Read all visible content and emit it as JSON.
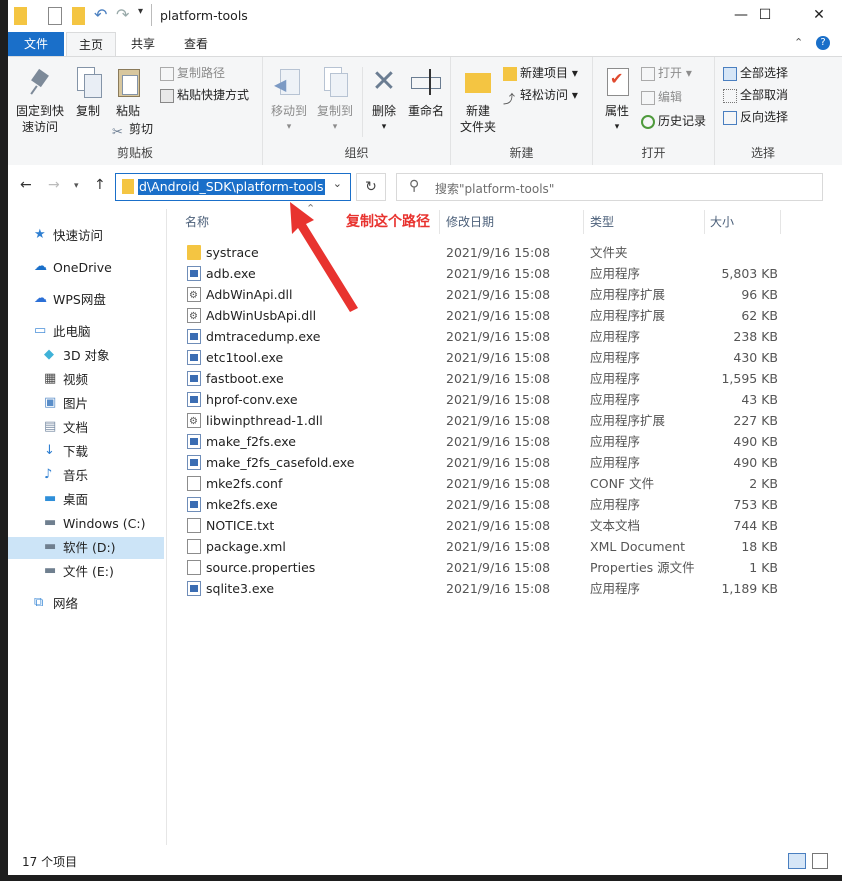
{
  "window": {
    "title": "platform-tools",
    "controls": {
      "minimize": "—",
      "maximize": "☐",
      "close": "✕"
    }
  },
  "tabs": [
    {
      "label": "文件"
    },
    {
      "label": "主页"
    },
    {
      "label": "共享"
    },
    {
      "label": "查看"
    }
  ],
  "ribbon": {
    "clipboard": {
      "group_label": "剪贴板",
      "pin_label_1": "固定到快",
      "pin_label_2": "速访问",
      "copy": "复制",
      "paste": "粘贴",
      "copy_path": "复制路径",
      "paste_shortcut": "粘贴快捷方式",
      "cut": "剪切"
    },
    "organize": {
      "group_label": "组织",
      "move_to": "移动到",
      "copy_to": "复制到",
      "delete": "删除",
      "rename": "重命名"
    },
    "new": {
      "group_label": "新建",
      "new_folder_1": "新建",
      "new_folder_2": "文件夹",
      "new_item": "新建项目 ▾",
      "easy_access": "轻松访问 ▾"
    },
    "open": {
      "group_label": "打开",
      "properties": "属性",
      "open": "打开 ▾",
      "edit": "编辑",
      "history": "历史记录"
    },
    "select": {
      "group_label": "选择",
      "select_all": "全部选择",
      "select_none": "全部取消",
      "invert": "反向选择"
    }
  },
  "address": {
    "path": "d\\Android_SDK\\platform-tools",
    "search_placeholder": "搜索\"platform-tools\""
  },
  "annotation": "复制这个路径",
  "nav_pane": [
    {
      "label": "快速访问",
      "icon": "star-icon"
    },
    {
      "label": "OneDrive",
      "icon": "cloud-icon"
    },
    {
      "label": "WPS网盘",
      "icon": "cloud-outline-icon"
    },
    {
      "label": "此电脑",
      "icon": "computer-icon"
    },
    {
      "label": "3D 对象",
      "icon": "cube-icon"
    },
    {
      "label": "视频",
      "icon": "film-icon"
    },
    {
      "label": "图片",
      "icon": "picture-icon"
    },
    {
      "label": "文档",
      "icon": "document-icon"
    },
    {
      "label": "下载",
      "icon": "download-icon"
    },
    {
      "label": "音乐",
      "icon": "music-icon"
    },
    {
      "label": "桌面",
      "icon": "desktop-icon"
    },
    {
      "label": "Windows (C:)",
      "icon": "drive-icon"
    },
    {
      "label": "软件 (D:)",
      "icon": "drive-icon"
    },
    {
      "label": "文件 (E:)",
      "icon": "drive-icon"
    },
    {
      "label": "网络",
      "icon": "network-icon"
    }
  ],
  "columns": {
    "name": "名称",
    "date": "修改日期",
    "type": "类型",
    "size": "大小"
  },
  "files": [
    {
      "name": "systrace",
      "date": "2021/9/16 15:08",
      "type": "文件夹",
      "size": "",
      "icon": "folder"
    },
    {
      "name": "adb.exe",
      "date": "2021/9/16 15:08",
      "type": "应用程序",
      "size": "5,803 KB",
      "icon": "exe"
    },
    {
      "name": "AdbWinApi.dll",
      "date": "2021/9/16 15:08",
      "type": "应用程序扩展",
      "size": "96 KB",
      "icon": "gear"
    },
    {
      "name": "AdbWinUsbApi.dll",
      "date": "2021/9/16 15:08",
      "type": "应用程序扩展",
      "size": "62 KB",
      "icon": "gear"
    },
    {
      "name": "dmtracedump.exe",
      "date": "2021/9/16 15:08",
      "type": "应用程序",
      "size": "238 KB",
      "icon": "exe"
    },
    {
      "name": "etc1tool.exe",
      "date": "2021/9/16 15:08",
      "type": "应用程序",
      "size": "430 KB",
      "icon": "exe"
    },
    {
      "name": "fastboot.exe",
      "date": "2021/9/16 15:08",
      "type": "应用程序",
      "size": "1,595 KB",
      "icon": "exe"
    },
    {
      "name": "hprof-conv.exe",
      "date": "2021/9/16 15:08",
      "type": "应用程序",
      "size": "43 KB",
      "icon": "exe"
    },
    {
      "name": "libwinpthread-1.dll",
      "date": "2021/9/16 15:08",
      "type": "应用程序扩展",
      "size": "227 KB",
      "icon": "gear"
    },
    {
      "name": "make_f2fs.exe",
      "date": "2021/9/16 15:08",
      "type": "应用程序",
      "size": "490 KB",
      "icon": "exe"
    },
    {
      "name": "make_f2fs_casefold.exe",
      "date": "2021/9/16 15:08",
      "type": "应用程序",
      "size": "490 KB",
      "icon": "exe"
    },
    {
      "name": "mke2fs.conf",
      "date": "2021/9/16 15:08",
      "type": "CONF 文件",
      "size": "2 KB",
      "icon": "doc"
    },
    {
      "name": "mke2fs.exe",
      "date": "2021/9/16 15:08",
      "type": "应用程序",
      "size": "753 KB",
      "icon": "exe"
    },
    {
      "name": "NOTICE.txt",
      "date": "2021/9/16 15:08",
      "type": "文本文档",
      "size": "744 KB",
      "icon": "doc"
    },
    {
      "name": "package.xml",
      "date": "2021/9/16 15:08",
      "type": "XML Document",
      "size": "18 KB",
      "icon": "doc"
    },
    {
      "name": "source.properties",
      "date": "2021/9/16 15:08",
      "type": "Properties 源文件",
      "size": "1 KB",
      "icon": "doc"
    },
    {
      "name": "sqlite3.exe",
      "date": "2021/9/16 15:08",
      "type": "应用程序",
      "size": "1,189 KB",
      "icon": "exe"
    }
  ],
  "status": {
    "count": "17 个项目"
  },
  "colors": {
    "accent": "#1a6fc9",
    "annotation": "#e8332f",
    "selection": "#cce4f7"
  }
}
